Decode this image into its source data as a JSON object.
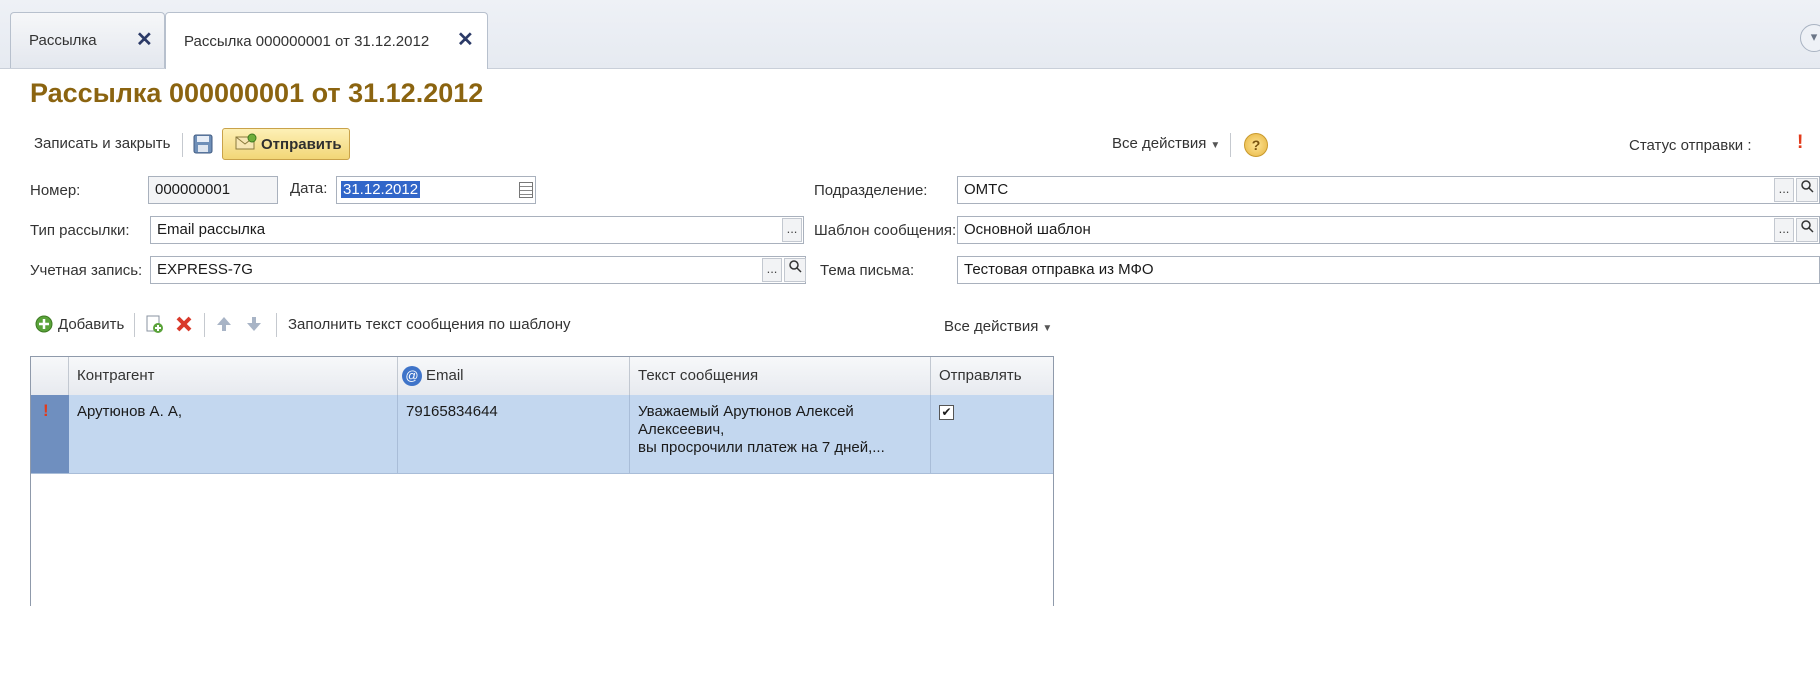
{
  "tabs": [
    {
      "label": "Рассылка",
      "close": "✕",
      "active": false
    },
    {
      "label": "Рассылка 000000001 от 31.12.2012",
      "close": "✕",
      "active": true
    }
  ],
  "title": "Рассылка 000000001 от 31.12.2012",
  "toolbar": {
    "save_close": "Записать и закрыть",
    "send": "Отправить",
    "all_actions": "Все действия",
    "help": "?",
    "send_status_label": "Статус отправки :",
    "send_status_value": "!"
  },
  "form": {
    "number_label": "Номер:",
    "number_value": "000000001",
    "date_label": "Дата:",
    "date_value": "31.12.2012",
    "division_label": "Подразделение:",
    "division_value": "ОМТС",
    "mailing_type_label": "Тип рассылки:",
    "mailing_type_value": "Email рассылка",
    "template_label": "Шаблон сообщения:",
    "template_value": "Основной шаблон",
    "account_label": "Учетная запись:",
    "account_value": "EXPRESS-7G",
    "subject_label": "Тема письма:",
    "subject_value": "Тестовая отправка из МФО",
    "ellipsis": "...",
    "search": "🔍"
  },
  "table_toolbar": {
    "add": "Добавить",
    "fill_by_template": "Заполнить текст сообщения по шаблону",
    "all_actions": "Все действия"
  },
  "table": {
    "columns": [
      "Контрагент",
      "Email",
      "Текст сообщения",
      "Отправлять"
    ],
    "rows": [
      {
        "marker": "!",
        "counterparty": "Арутюнов А. А,",
        "email": "79165834644",
        "text_line1": "Уважаемый Арутюнов Алексей",
        "text_line2": "Алексеевич,",
        "text_line3": "вы просрочили платеж на 7 дней,...",
        "send_check": "✔"
      }
    ]
  },
  "colors": {
    "title": "#8b6410",
    "selected_row": "#c3d7ef",
    "row_marker": "#6f8fbf",
    "accent_button": "#f2d677"
  }
}
